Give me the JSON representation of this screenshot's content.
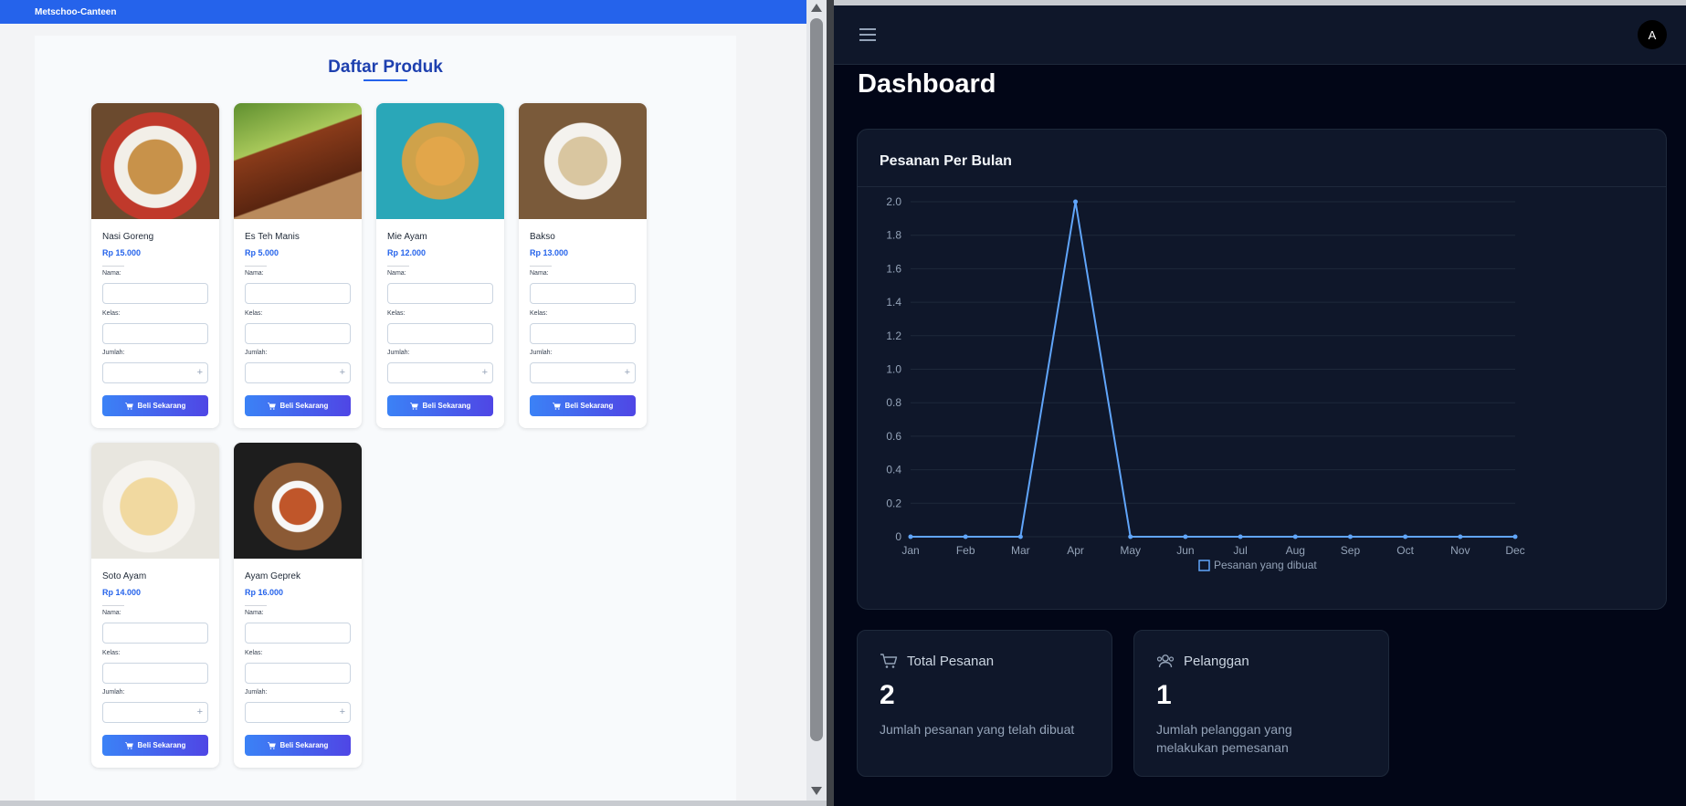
{
  "left_app": {
    "brand": "Metschoo-Canteen",
    "page_title": "Daftar Produk",
    "form_labels": {
      "name": "Nama:",
      "class": "Kelas:",
      "qty": "Jumlah:"
    },
    "buy_label": "Beli Sekarang",
    "products": [
      {
        "name": "Nasi Goreng",
        "price": "Rp 15.000"
      },
      {
        "name": "Es Teh Manis",
        "price": "Rp 5.000"
      },
      {
        "name": "Mie Ayam",
        "price": "Rp 12.000"
      },
      {
        "name": "Bakso",
        "price": "Rp 13.000"
      },
      {
        "name": "Soto Ayam",
        "price": "Rp 14.000"
      },
      {
        "name": "Ayam Geprek",
        "price": "Rp 16.000"
      }
    ]
  },
  "dashboard": {
    "avatar_initial": "A",
    "title": "Dashboard",
    "chart_card_title": "Pesanan Per Bulan",
    "stats": [
      {
        "label": "Total Pesanan",
        "value": "2",
        "description": "Jumlah pesanan yang telah dibuat",
        "icon": "cart-icon"
      },
      {
        "label": "Pelanggan",
        "value": "1",
        "description": "Jumlah pelanggan yang melakukan pemesanan",
        "icon": "users-icon"
      }
    ]
  },
  "chart_data": {
    "type": "line",
    "x": [
      "Jan",
      "Feb",
      "Mar",
      "Apr",
      "May",
      "Jun",
      "Jul",
      "Aug",
      "Sep",
      "Oct",
      "Nov",
      "Dec"
    ],
    "series": [
      {
        "name": "Pesanan yang dibuat",
        "values": [
          0,
          0,
          0,
          2,
          0,
          0,
          0,
          0,
          0,
          0,
          0,
          0
        ]
      }
    ],
    "ylim": [
      0,
      2
    ],
    "yticks": [
      "0",
      "0.2",
      "0.4",
      "0.6",
      "0.8",
      "1.0",
      "1.2",
      "1.4",
      "1.6",
      "1.8",
      "2.0"
    ],
    "grid": true,
    "legend": "bottom",
    "color": "#60a5fa"
  }
}
